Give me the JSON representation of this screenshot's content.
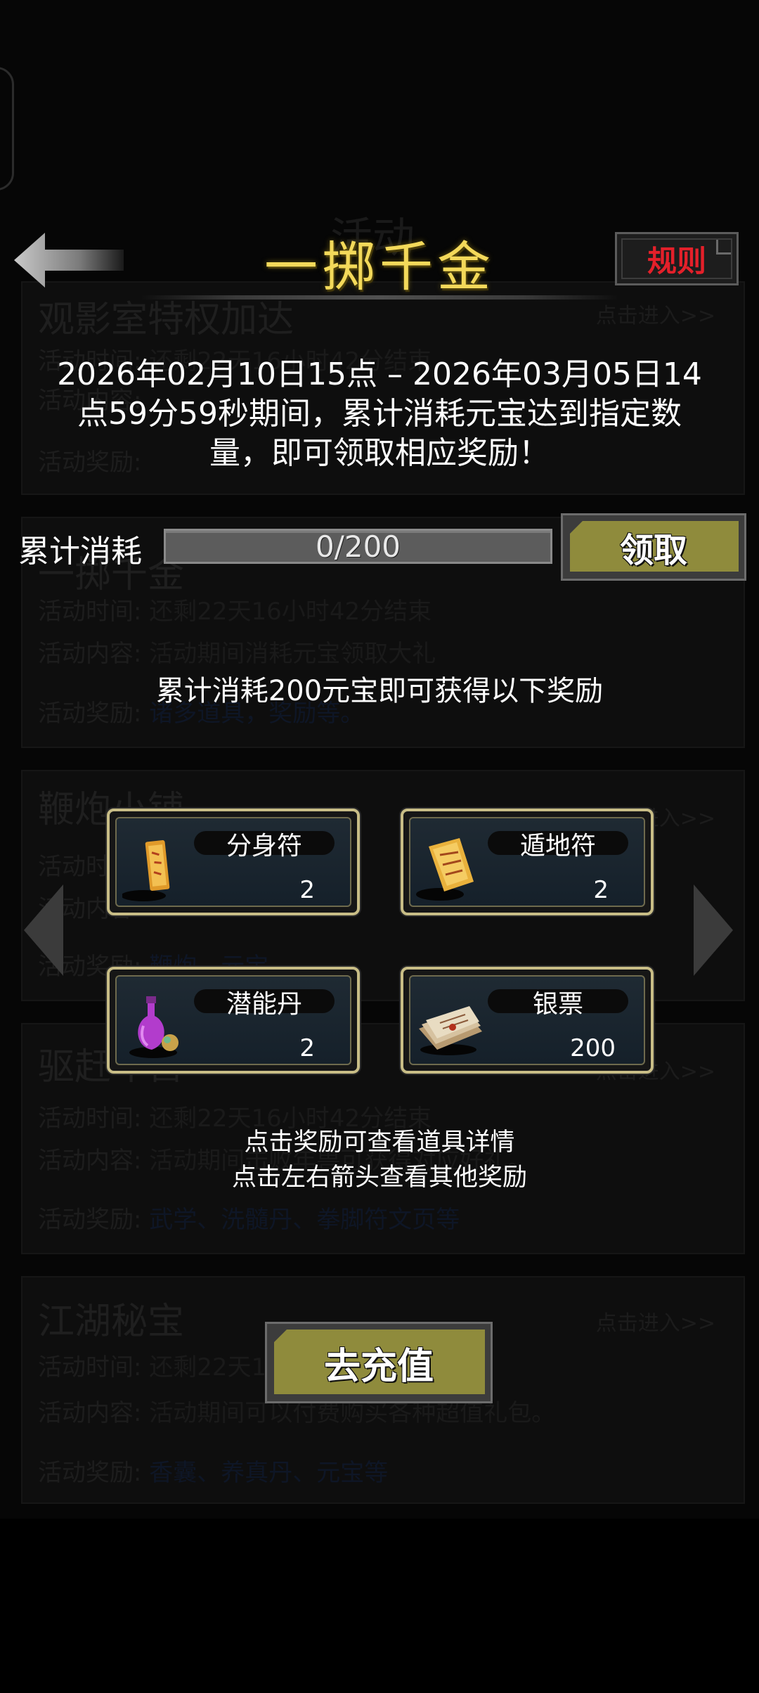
{
  "header": {
    "title": "一掷千金",
    "rule_label": "规则"
  },
  "description": "2026年02月10日15点 – 2026年03月05日14点59分59秒期间，累计消耗元宝达到指定数量，即可领取相应奖励！",
  "progress": {
    "label": "累计消耗",
    "text": "0/200",
    "current": 0,
    "target": 200,
    "claim_label": "领取"
  },
  "reward_hint": "累计消耗200元宝即可获得以下奖励",
  "rewards": [
    {
      "name": "分身符",
      "count": "2",
      "icon": "talisman-icon"
    },
    {
      "name": "遁地符",
      "count": "2",
      "icon": "scroll-talisman-icon"
    },
    {
      "name": "潜能丹",
      "count": "2",
      "icon": "potion-bottle-icon"
    },
    {
      "name": "银票",
      "count": "200",
      "icon": "banknote-icon"
    }
  ],
  "tips": [
    "点击奖励可查看道具详情",
    "点击左右箭头查看其他奖励"
  ],
  "recharge_label": "去充值",
  "background_list": {
    "header_title": "活动",
    "row_labels": [
      "活动时间:",
      "活动内容:",
      "活动奖励:"
    ],
    "enter_label": "点击进入>>",
    "items": [
      {
        "title": "观影室特权加达",
        "time": "还剩22天16小时42分结束",
        "content": "",
        "reward": ""
      },
      {
        "title": "一掷千金",
        "time": "还剩22天16小时42分结束",
        "content": "活动期间消耗元宝领取大礼",
        "reward": "诸多道具，奖励等。"
      },
      {
        "title": "鞭炮小铺",
        "time": "",
        "content": "",
        "reward": "鞭炮、元宝"
      },
      {
        "title": "驱赶年兽",
        "time": "还剩22天16小时42分结束",
        "content": "活动期间击败年兽可获得对应好礼。",
        "reward": "武学、洗髓丹、拳脚符文页等"
      },
      {
        "title": "江湖秘宝",
        "time": "还剩22天16小时42分结束",
        "content": "活动期间可以付费购买各种超值礼包。",
        "reward": "香囊、养真丹、元宝等"
      }
    ]
  }
}
